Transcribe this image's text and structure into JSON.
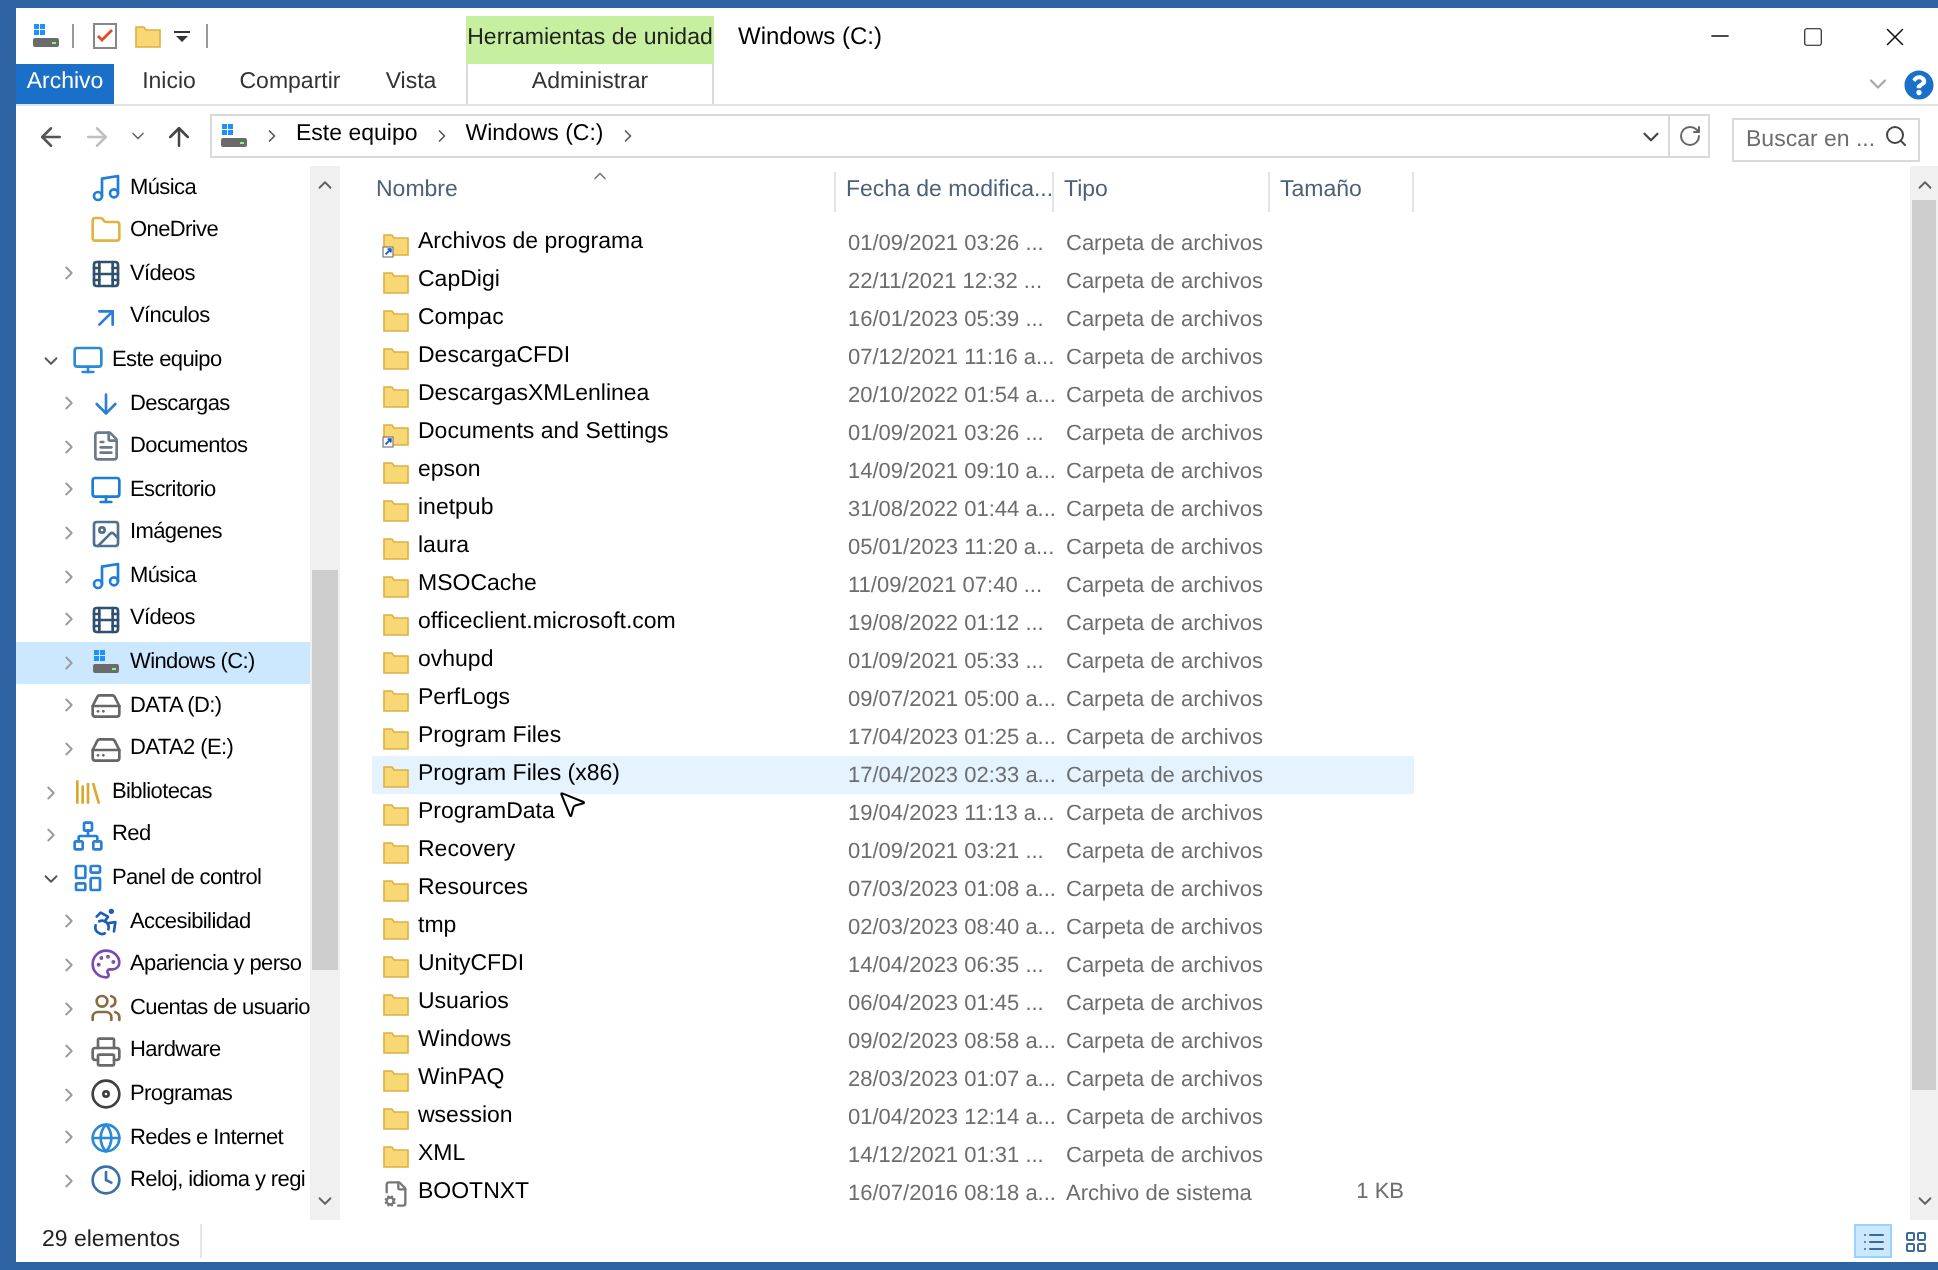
{
  "window": {
    "title": "Windows (C:)"
  },
  "contextual_group": {
    "label": "Herramientas de unidad"
  },
  "ribbon_tabs": [
    {
      "label": "Archivo",
      "kind": "file"
    },
    {
      "label": "Inicio",
      "kind": "tab"
    },
    {
      "label": "Compartir",
      "kind": "tab"
    },
    {
      "label": "Vista",
      "kind": "tab"
    },
    {
      "label": "Administrar",
      "kind": "contextual"
    }
  ],
  "address_bar": {
    "path": [
      "Este equipo",
      "Windows (C:)"
    ]
  },
  "search": {
    "placeholder": "Buscar en ..."
  },
  "nav_pane": {
    "continued_items": [
      {
        "label": "Música",
        "kind": "music",
        "expandable": false,
        "selected": false
      },
      {
        "label": "OneDrive",
        "kind": "folder",
        "expandable": false,
        "selected": false
      },
      {
        "label": "Vídeos",
        "kind": "video",
        "expandable": true,
        "expanded": false,
        "selected": false
      },
      {
        "label": "Vínculos",
        "kind": "link",
        "expandable": false,
        "selected": false
      }
    ],
    "items": [
      {
        "label": "Este equipo",
        "kind": "computer",
        "expandable": true,
        "expanded": true,
        "selected": false,
        "children": [
          {
            "label": "Descargas",
            "kind": "download",
            "expandable": true,
            "expanded": false,
            "selected": false
          },
          {
            "label": "Documentos",
            "kind": "document",
            "expandable": true,
            "expanded": false,
            "selected": false
          },
          {
            "label": "Escritorio",
            "kind": "desktop",
            "expandable": true,
            "expanded": false,
            "selected": false
          },
          {
            "label": "Imágenes",
            "kind": "image",
            "expandable": true,
            "expanded": false,
            "selected": false
          },
          {
            "label": "Música",
            "kind": "music",
            "expandable": true,
            "expanded": false,
            "selected": false
          },
          {
            "label": "Vídeos",
            "kind": "video",
            "expandable": true,
            "expanded": false,
            "selected": false
          },
          {
            "label": "Windows (C:)",
            "kind": "system-drive",
            "expandable": true,
            "expanded": false,
            "selected": true
          },
          {
            "label": "DATA (D:)",
            "kind": "drive",
            "expandable": true,
            "expanded": false,
            "selected": false
          },
          {
            "label": "DATA2 (E:)",
            "kind": "drive",
            "expandable": true,
            "expanded": false,
            "selected": false
          }
        ]
      },
      {
        "label": "Bibliotecas",
        "kind": "library",
        "expandable": true,
        "expanded": false,
        "selected": false
      },
      {
        "label": "Red",
        "kind": "network",
        "expandable": true,
        "expanded": false,
        "selected": false
      },
      {
        "label": "Panel de control",
        "kind": "control-panel",
        "expandable": true,
        "expanded": true,
        "selected": false,
        "children": [
          {
            "label": "Accesibilidad",
            "kind": "accessibility",
            "expandable": true,
            "expanded": false,
            "selected": false
          },
          {
            "label": "Apariencia y perso",
            "kind": "appearance",
            "expandable": true,
            "expanded": false,
            "selected": false
          },
          {
            "label": "Cuentas de usuario",
            "kind": "users",
            "expandable": true,
            "expanded": false,
            "selected": false
          },
          {
            "label": "Hardware",
            "kind": "hardware",
            "expandable": true,
            "expanded": false,
            "selected": false
          },
          {
            "label": "Programas",
            "kind": "programs",
            "expandable": true,
            "expanded": false,
            "selected": false
          },
          {
            "label": "Redes e Internet",
            "kind": "internet",
            "expandable": true,
            "expanded": false,
            "selected": false
          },
          {
            "label": "Reloj, idioma y regi",
            "kind": "clock",
            "expandable": true,
            "expanded": false,
            "selected": false
          }
        ]
      }
    ]
  },
  "file_list": {
    "columns": [
      {
        "label": "Nombre",
        "sorted": true
      },
      {
        "label": "Fecha de modifica...",
        "sorted": false
      },
      {
        "label": "Tipo",
        "sorted": false
      },
      {
        "label": "Tamaño",
        "sorted": false
      }
    ],
    "rows": [
      {
        "name": "Archivos de programa",
        "modified": "01/09/2021 03:26 ...",
        "type": "Carpeta de archivos",
        "kind": "link",
        "hovered": false
      },
      {
        "name": "CapDigi",
        "modified": "22/11/2021 12:32 ...",
        "type": "Carpeta de archivos",
        "kind": "folder",
        "hovered": false
      },
      {
        "name": "Compac",
        "modified": "16/01/2023 05:39 ...",
        "type": "Carpeta de archivos",
        "kind": "folder",
        "hovered": false
      },
      {
        "name": "DescargaCFDI",
        "modified": "07/12/2021 11:16 a...",
        "type": "Carpeta de archivos",
        "kind": "folder",
        "hovered": false
      },
      {
        "name": "DescargasXMLenlinea",
        "modified": "20/10/2022 01:54 a...",
        "type": "Carpeta de archivos",
        "kind": "folder",
        "hovered": false
      },
      {
        "name": "Documents and Settings",
        "modified": "01/09/2021 03:26 ...",
        "type": "Carpeta de archivos",
        "kind": "link",
        "hovered": false
      },
      {
        "name": "epson",
        "modified": "14/09/2021 09:10 a...",
        "type": "Carpeta de archivos",
        "kind": "folder",
        "hovered": false
      },
      {
        "name": "inetpub",
        "modified": "31/08/2022 01:44 a...",
        "type": "Carpeta de archivos",
        "kind": "folder",
        "hovered": false
      },
      {
        "name": "laura",
        "modified": "05/01/2023 11:20 a...",
        "type": "Carpeta de archivos",
        "kind": "folder",
        "hovered": false
      },
      {
        "name": "MSOCache",
        "modified": "11/09/2021 07:40 ...",
        "type": "Carpeta de archivos",
        "kind": "folder",
        "hovered": false
      },
      {
        "name": "officeclient.microsoft.com",
        "modified": "19/08/2022 01:12 ...",
        "type": "Carpeta de archivos",
        "kind": "folder",
        "hovered": false
      },
      {
        "name": "ovhupd",
        "modified": "01/09/2021 05:33 ...",
        "type": "Carpeta de archivos",
        "kind": "folder",
        "hovered": false
      },
      {
        "name": "PerfLogs",
        "modified": "09/07/2021 05:00 a...",
        "type": "Carpeta de archivos",
        "kind": "folder",
        "hovered": false
      },
      {
        "name": "Program Files",
        "modified": "17/04/2023 01:25 a...",
        "type": "Carpeta de archivos",
        "kind": "folder",
        "hovered": false
      },
      {
        "name": "Program Files (x86)",
        "modified": "17/04/2023 02:33 a...",
        "type": "Carpeta de archivos",
        "kind": "folder",
        "hovered": true
      },
      {
        "name": "ProgramData",
        "modified": "19/04/2023 11:13 a...",
        "type": "Carpeta de archivos",
        "kind": "folder",
        "hovered": false
      },
      {
        "name": "Recovery",
        "modified": "01/09/2021 03:21 ...",
        "type": "Carpeta de archivos",
        "kind": "folder",
        "hovered": false
      },
      {
        "name": "Resources",
        "modified": "07/03/2023 01:08 a...",
        "type": "Carpeta de archivos",
        "kind": "folder",
        "hovered": false
      },
      {
        "name": "tmp",
        "modified": "02/03/2023 08:40 a...",
        "type": "Carpeta de archivos",
        "kind": "folder",
        "hovered": false
      },
      {
        "name": "UnityCFDI",
        "modified": "14/04/2023 06:35 ...",
        "type": "Carpeta de archivos",
        "kind": "folder",
        "hovered": false
      },
      {
        "name": "Usuarios",
        "modified": "06/04/2023 01:45 ...",
        "type": "Carpeta de archivos",
        "kind": "folder",
        "hovered": false
      },
      {
        "name": "Windows",
        "modified": "09/02/2023 08:58 a...",
        "type": "Carpeta de archivos",
        "kind": "folder",
        "hovered": false
      },
      {
        "name": "WinPAQ",
        "modified": "28/03/2023 01:07 a...",
        "type": "Carpeta de archivos",
        "kind": "folder",
        "hovered": false
      },
      {
        "name": "wsession",
        "modified": "01/04/2023 12:14 a...",
        "type": "Carpeta de archivos",
        "kind": "folder",
        "hovered": false
      },
      {
        "name": "XML",
        "modified": "14/12/2021 01:31 ...",
        "type": "Carpeta de archivos",
        "kind": "folder",
        "hovered": false
      },
      {
        "name": "BOOTNXT",
        "modified": "16/07/2016 08:18 a...",
        "type": "Archivo de sistema",
        "size": "1 KB",
        "kind": "file",
        "hovered": false
      }
    ]
  },
  "status_bar": {
    "item_count": "29 elementos"
  },
  "view_buttons": [
    {
      "kind": "details",
      "selected": true
    },
    {
      "kind": "large-icons",
      "selected": false
    }
  ]
}
